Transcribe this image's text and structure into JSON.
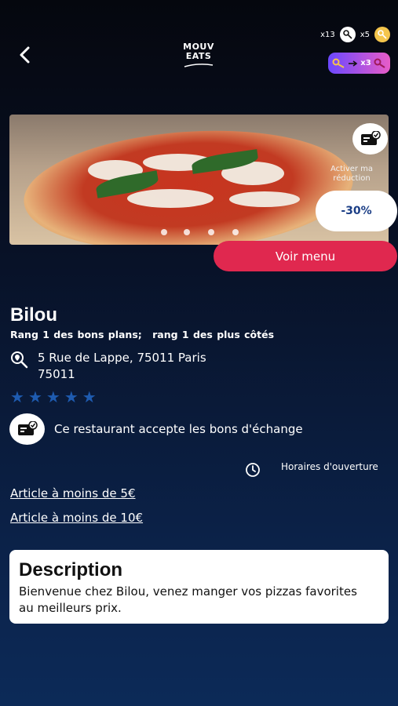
{
  "header": {
    "logo_line1": "MOUV",
    "logo_line2": "EATS",
    "white_keys_count": "x13",
    "gold_keys_count": "x5",
    "exchange_count": "x3"
  },
  "hero": {
    "image_subject": "pizza-photo",
    "carousel_dots": 4,
    "activate_label": "Activer ma réduction",
    "discount": "-30%",
    "menu_button": "Voir menu"
  },
  "restaurant": {
    "name": "Bilou",
    "rank_deals": "Rang 1 des bons plans;",
    "rank_rated": "rang 1 des plus côtés",
    "address_line1": "5 Rue de Lappe, 75011 Paris",
    "address_line2": "75011",
    "rating": 5,
    "rating_max": 5,
    "accepts_vouchers": "Ce restaurant accepte les bons d'échange",
    "hours_label": "Horaires d'ouverture"
  },
  "links": {
    "under5": "Article à moins de 5€",
    "under10": "Article à moins de 10€"
  },
  "description": {
    "title": "Description",
    "text": "Bienvenue chez Bilou, venez manger vos pizzas favorites au meilleurs prix."
  },
  "colors": {
    "accent_red": "#e0284f",
    "star_blue": "#1e5bb0",
    "exchange_gradient_start": "#6b48ff",
    "exchange_gradient_end": "#e85cc8"
  },
  "icons": [
    "back-icon",
    "key-icon",
    "voucher-icon",
    "location-search-icon",
    "star-icon",
    "clock-icon"
  ]
}
